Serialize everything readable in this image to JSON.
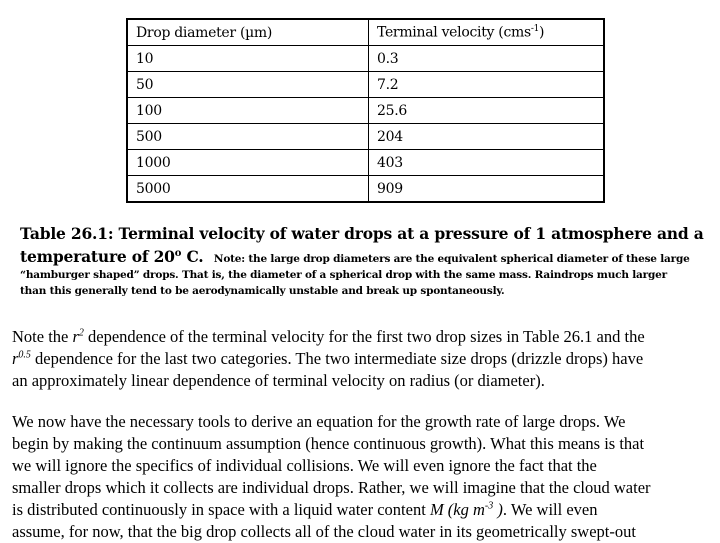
{
  "table": {
    "headers": [
      "Drop diameter (µm)",
      "Terminal velocity (cms",
      "-1",
      ")"
    ],
    "header_diameter": "Drop diameter (µm)",
    "header_velocity_base": "Terminal velocity (cms",
    "header_velocity_sup": "-1",
    "header_velocity_close": ")",
    "rows": [
      {
        "diameter": "10",
        "velocity": "0.3"
      },
      {
        "diameter": "50",
        "velocity": "7.2"
      },
      {
        "diameter": "100",
        "velocity": "25.6"
      },
      {
        "diameter": "500",
        "velocity": "204"
      },
      {
        "diameter": "1000",
        "velocity": "403"
      },
      {
        "diameter": "5000",
        "velocity": "909"
      }
    ]
  },
  "caption": {
    "line1": "Table 26.1: Terminal velocity of water drops at a pressure of 1 atmosphere and a",
    "line2_a": "temperature of 20",
    "line2_sup": "o",
    "line2_b": " C.",
    "line2_note": "Note: the large drop diameters are the equivalent spherical diameter of these large",
    "line3": "“hamburger shaped” drops. That is, the diameter of a spherical drop with the same mass. Raindrops much larger",
    "line4": "than this generally tend to be aerodynamically unstable and break up spontaneously."
  },
  "paragraph1": {
    "l1_a": "Note the ",
    "l1_r": "r",
    "l1_sup": "2",
    "l1_b": " dependence of the terminal velocity for the first two drop sizes in Table 26.1 and the",
    "l2_r": "r",
    "l2_sup": "0.5",
    "l2_b": " dependence for the last two categories. The two intermediate size drops (drizzle drops) have",
    "l3": "an approximately linear dependence of terminal velocity on radius (or diameter)."
  },
  "paragraph2": {
    "l1": "We now have the necessary tools to derive an equation for the growth rate of large drops. We",
    "l2": "begin by making the continuum assumption (hence continuous growth). What this means is that",
    "l3": "we will ignore the specifics of individual collisions. We will even ignore the fact that the",
    "l4": "smaller drops which it collects are individual drops. Rather, we will imagine that the cloud water",
    "l5_a": "is distributed continuously in space with a liquid water content ",
    "l5_M": "M (kg m",
    "l5_sup": "-3",
    "l5_close": " )",
    "l5_b": ". We will even",
    "l6": "assume, for now, that the big drop collects all of the cloud water in its geometrically swept-out"
  }
}
